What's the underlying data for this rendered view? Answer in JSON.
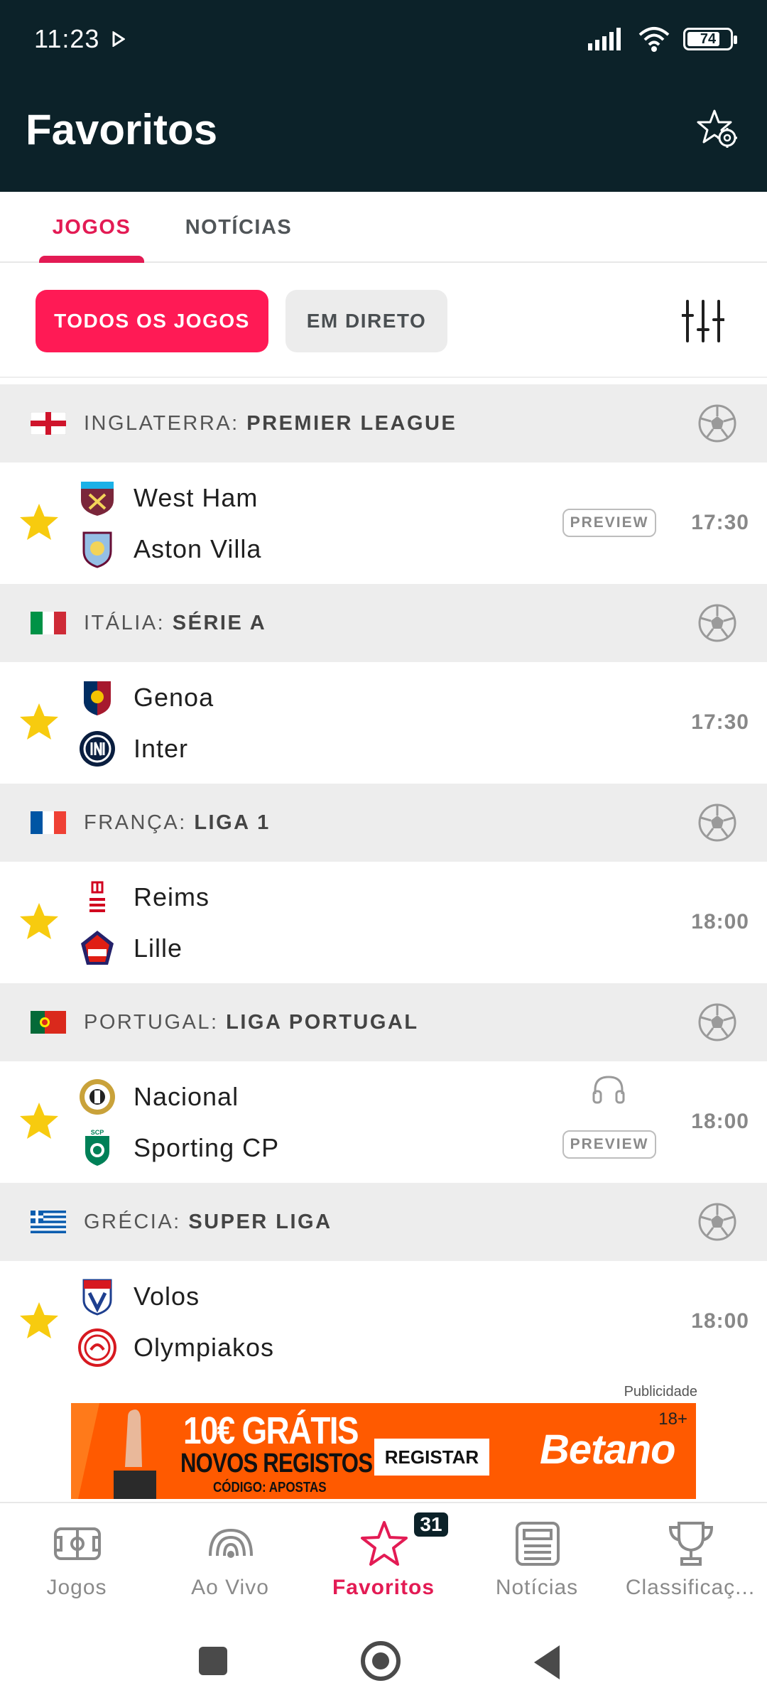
{
  "status_bar": {
    "time": "11:23",
    "battery": "74"
  },
  "header": {
    "title": "Favoritos"
  },
  "tabs": [
    {
      "label": "JOGOS",
      "active": true
    },
    {
      "label": "NOTÍCIAS",
      "active": false
    }
  ],
  "filters": {
    "all_games": "TODOS OS JOGOS",
    "live": "EM DIRETO"
  },
  "leagues": [
    {
      "country": "INGLATERRA: ",
      "league": "PREMIER LEAGUE",
      "match": {
        "home": "West Ham",
        "away": "Aston Villa",
        "time": "17:30",
        "preview": "PREVIEW"
      }
    },
    {
      "country": "ITÁLIA: ",
      "league": "SÉRIE A",
      "match": {
        "home": "Genoa",
        "away": "Inter",
        "time": "17:30"
      }
    },
    {
      "country": "FRANÇA: ",
      "league": "LIGA 1",
      "match": {
        "home": "Reims",
        "away": "Lille",
        "time": "18:00"
      }
    },
    {
      "country": "PORTUGAL: ",
      "league": "LIGA PORTUGAL",
      "match": {
        "home": "Nacional",
        "away": "Sporting CP",
        "time": "18:00",
        "preview": "PREVIEW"
      }
    },
    {
      "country": "GRÉCIA: ",
      "league": "SUPER LIGA",
      "match": {
        "home": "Volos",
        "away": "Olympiakos",
        "time": "18:00"
      }
    }
  ],
  "ad": {
    "label": "Publicidade",
    "age": "18+",
    "headline": "10€ GRÁTIS",
    "subline": "NOVOS REGISTOS",
    "code": "CÓDIGO: APOSTAS",
    "cta": "REGISTAR",
    "brand": "Betano"
  },
  "bottom_nav": {
    "items": [
      {
        "label": "Jogos",
        "icon": "field-icon"
      },
      {
        "label": "Ao Vivo",
        "icon": "live-signal-icon"
      },
      {
        "label": "Favoritos",
        "icon": "star-icon",
        "active": true
      },
      {
        "label": "Notícias",
        "icon": "newspaper-icon"
      },
      {
        "label": "Classificaç...",
        "icon": "trophy-icon"
      }
    ],
    "favorites_badge": "31"
  },
  "colors": {
    "header_bg": "#0c2229",
    "accent": "#e31b54",
    "star": "#f7cb0f"
  }
}
